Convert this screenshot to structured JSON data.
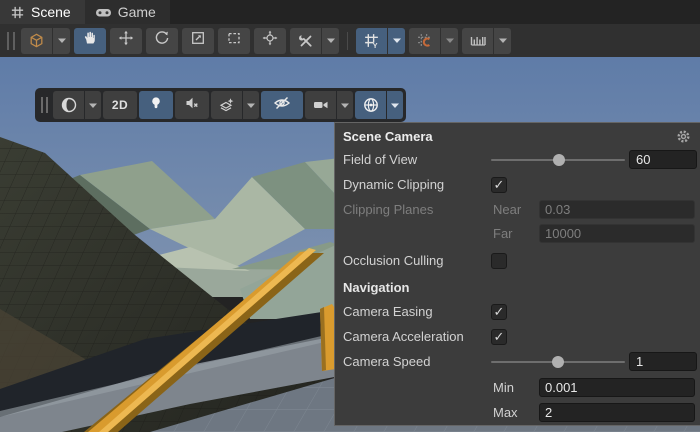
{
  "tabs": {
    "scene": {
      "label": "Scene"
    },
    "game": {
      "label": "Game"
    }
  },
  "overlay_toolbar": {
    "label_2d": "2D"
  },
  "popup": {
    "title": "Scene Camera",
    "fov": {
      "label": "Field of View",
      "value": "60",
      "thumb_percent": 51
    },
    "dynamic_clipping": {
      "label": "Dynamic Clipping",
      "checked": true
    },
    "clipping_planes": {
      "label": "Clipping Planes",
      "near_label": "Near",
      "near_value": "0.03",
      "far_label": "Far",
      "far_value": "10000",
      "disabled": true
    },
    "occlusion_culling": {
      "label": "Occlusion Culling",
      "checked": false
    },
    "navigation_header": "Navigation",
    "camera_easing": {
      "label": "Camera Easing",
      "checked": true
    },
    "camera_acceleration": {
      "label": "Camera Acceleration",
      "checked": true
    },
    "camera_speed": {
      "label": "Camera Speed",
      "value": "1",
      "thumb_percent": 50,
      "min_label": "Min",
      "min_value": "0.001",
      "max_label": "Max",
      "max_value": "2"
    }
  },
  "colors": {
    "selected_blue": "#46607e",
    "panel_bg": "#3c3c3c",
    "toolbar_bg": "#303030",
    "field_bg": "#232323",
    "cube_orange": "#c08b4a",
    "snap_orange": "#c56a3a",
    "rail_orange": "#d99b2e",
    "sky_blue": "#5f7ca8"
  }
}
